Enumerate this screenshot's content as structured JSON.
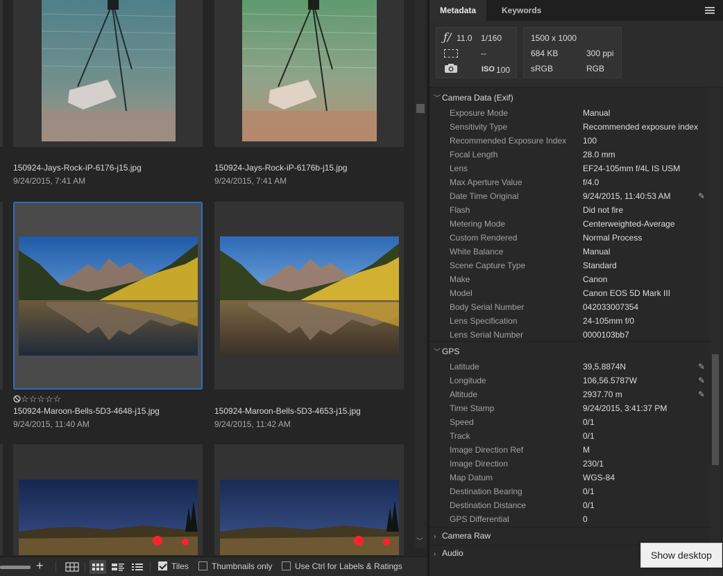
{
  "content": {
    "tiles": [
      {
        "name": "150924-Jays-Rock-iP-6176-j15.jpg",
        "date": "9/24/2015, 7:41 AM"
      },
      {
        "name": "150924-Jays-Rock-iP-6176b-j15.jpg",
        "date": "9/24/2015, 7:41 AM"
      },
      {
        "name": "150924-Maroon-Bells-5D3-4648-j15.jpg",
        "date": "9/24/2015, 11:40 AM"
      },
      {
        "name": "150924-Maroon-Bells-5D3-4653-j15.jpg",
        "date": "9/24/2015, 11:42 AM"
      }
    ],
    "rating_text": "☆☆☆☆☆",
    "reject_icon": "reject-icon"
  },
  "bottombar": {
    "add_label": "+",
    "tiles_label": "Tiles",
    "thumbnails_only_label": "Thumbnails only",
    "ctrl_labels_label": "Use Ctrl for Labels & Ratings",
    "tiles_checked": true,
    "thumbnails_only_checked": false,
    "ctrl_labels_checked": false
  },
  "tabs": [
    {
      "label": "Metadata",
      "active": true
    },
    {
      "label": "Keywords",
      "active": false
    }
  ],
  "info": {
    "aperture_symbol": "ƒ/",
    "aperture": "11.0",
    "shutter": "1/160",
    "metering_placeholder": "--",
    "iso_label": "ISO",
    "iso": "100",
    "dimensions": "1500 x 1000",
    "file_size": "684 KB",
    "resolution": "300 ppi",
    "color_profile": "sRGB",
    "color_mode": "RGB"
  },
  "sections": {
    "exif_title": "Camera Data (Exif)",
    "gps_title": "GPS",
    "camera_raw_title": "Camera Raw",
    "audio_title": "Audio"
  },
  "exif": [
    {
      "k": "Exposure Mode",
      "v": "Manual"
    },
    {
      "k": "Sensitivity Type",
      "v": "Recommended exposure index"
    },
    {
      "k": "Recommended Exposure Index",
      "v": "100"
    },
    {
      "k": "Focal Length",
      "v": "28.0 mm"
    },
    {
      "k": "Lens",
      "v": "EF24-105mm f/4L IS USM"
    },
    {
      "k": "Max Aperture Value",
      "v": "f/4.0"
    },
    {
      "k": "Date Time Original",
      "v": "9/24/2015, 11:40:53 AM"
    },
    {
      "k": "Flash",
      "v": "Did not fire"
    },
    {
      "k": "Metering Mode",
      "v": "Centerweighted-Average"
    },
    {
      "k": "Custom Rendered",
      "v": "Normal Process"
    },
    {
      "k": "White Balance",
      "v": "Manual"
    },
    {
      "k": "Scene Capture Type",
      "v": "Standard"
    },
    {
      "k": "Make",
      "v": "Canon"
    },
    {
      "k": "Model",
      "v": "Canon EOS 5D Mark III"
    },
    {
      "k": "Body Serial Number",
      "v": "042033007354"
    },
    {
      "k": "Lens Specification",
      "v": "24-105mm f/0"
    },
    {
      "k": "Lens Serial Number",
      "v": "0000103bb7"
    }
  ],
  "gps": [
    {
      "k": "Latitude",
      "v": "39,5.8874N"
    },
    {
      "k": "Longitude",
      "v": "106,56.5787W"
    },
    {
      "k": "Altitude",
      "v": "2937.70 m"
    },
    {
      "k": "Time Stamp",
      "v": "9/24/2015, 3:41:37 PM"
    },
    {
      "k": "Speed",
      "v": "0/1"
    },
    {
      "k": "Track",
      "v": "0/1"
    },
    {
      "k": "Image Direction Ref",
      "v": "M"
    },
    {
      "k": "Image Direction",
      "v": "230/1"
    },
    {
      "k": "Map Datum",
      "v": "WGS-84"
    },
    {
      "k": "Destination Bearing",
      "v": "0/1"
    },
    {
      "k": "Destination Distance",
      "v": "0/1"
    },
    {
      "k": "GPS Differential",
      "v": "0"
    }
  ],
  "tooltip": "Show desktop",
  "colors": {
    "selection": "#2d6cc2",
    "panel_bg": "#282828",
    "content_bg": "#252525"
  }
}
